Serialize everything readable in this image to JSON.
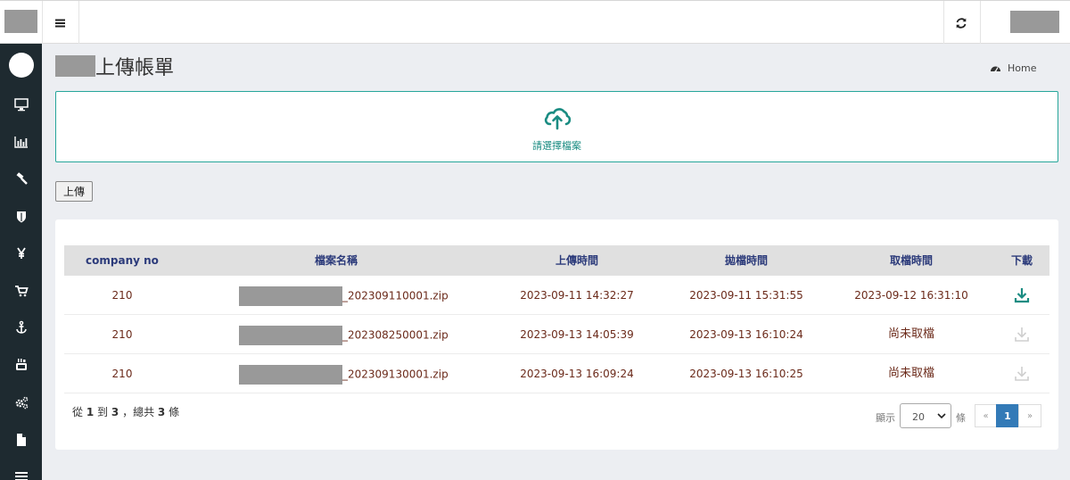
{
  "header": {
    "page_title": "上傳帳單",
    "breadcrumb": "Home"
  },
  "dropzone": {
    "label": "請選擇檔案"
  },
  "upload_button": "上傳",
  "table": {
    "columns": [
      "company no",
      "檔案名稱",
      "上傳時間",
      "拋檔時間",
      "取檔時間",
      "下載"
    ],
    "rows": [
      {
        "company_no": "210",
        "file_suffix": "_202309110001.zip",
        "upload_time": "2023-09-11 14:32:27",
        "push_time": "2023-09-11 15:31:55",
        "fetch_time": "2023-09-12 16:31:10",
        "download_enabled": true
      },
      {
        "company_no": "210",
        "file_suffix": "_202308250001.zip",
        "upload_time": "2023-09-13 14:05:39",
        "push_time": "2023-09-13 16:10:24",
        "fetch_time": "尚未取檔",
        "download_enabled": false
      },
      {
        "company_no": "210",
        "file_suffix": "_202309130001.zip",
        "upload_time": "2023-09-13 16:09:24",
        "push_time": "2023-09-13 16:10:25",
        "fetch_time": "尚未取檔",
        "download_enabled": false
      }
    ]
  },
  "footer": {
    "summary_from_label": "從",
    "summary_from": "1",
    "summary_to_label": "到",
    "summary_to": "3",
    "summary_total_label": "，總共",
    "summary_total": "3",
    "summary_unit": "條",
    "show_label": "顯示",
    "page_size": "20",
    "rows_label": "條",
    "pager_prev": "«",
    "pager_current": "1",
    "pager_next": "»"
  },
  "colors": {
    "sidebar": "#1e2a30",
    "accent": "#26a69a",
    "header_text": "#2b3a7a",
    "cell_text": "#6b2a1a",
    "pager_active": "#337ab7"
  },
  "icons": {
    "sidebar": [
      "monitor-icon",
      "bar-chart-icon",
      "gavel-icon",
      "shield-icon",
      "yen-icon",
      "cart-icon",
      "anchor-icon",
      "youtube-icon",
      "cogs-icon",
      "file-icon",
      "bars-icon"
    ],
    "topbar": [
      "bars-icon",
      "refresh-icon"
    ],
    "dropzone": "cloud-upload-icon",
    "breadcrumb": "dashboard-icon",
    "download": "download-icon"
  }
}
